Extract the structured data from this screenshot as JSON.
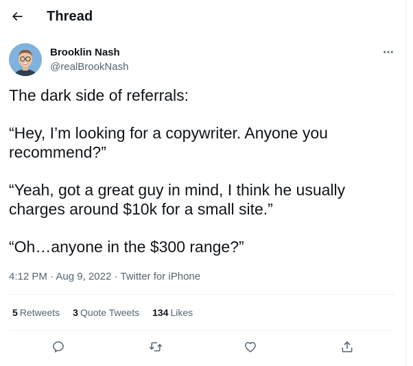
{
  "header": {
    "title": "Thread",
    "back_icon": "arrow-left-icon"
  },
  "author": {
    "display_name": "Brooklin Nash",
    "handle": "@realBrookNash"
  },
  "tweet": {
    "paragraphs": [
      "The dark side of referrals:",
      "“Hey, I’m looking for a copywriter. Anyone you recommend?”",
      "“Yeah, got a great guy in mind, I think he usually charges around $10k for a small site.”",
      "“Oh…anyone in the $300 range?”"
    ],
    "time": "4:12 PM",
    "date": "Aug 9, 2022",
    "separator": "·",
    "source": "Twitter for iPhone"
  },
  "stats": {
    "retweets_count": "5",
    "retweets_label": "Retweets",
    "quotes_count": "3",
    "quotes_label": "Quote Tweets",
    "likes_count": "134",
    "likes_label": "Likes"
  },
  "actions": [
    "reply-icon",
    "retweet-icon",
    "like-icon",
    "share-icon"
  ],
  "colors": {
    "text": "#0f1419",
    "secondary": "#536471",
    "divider": "#eff3f4",
    "avatar_bg": "#7fb2dd"
  }
}
